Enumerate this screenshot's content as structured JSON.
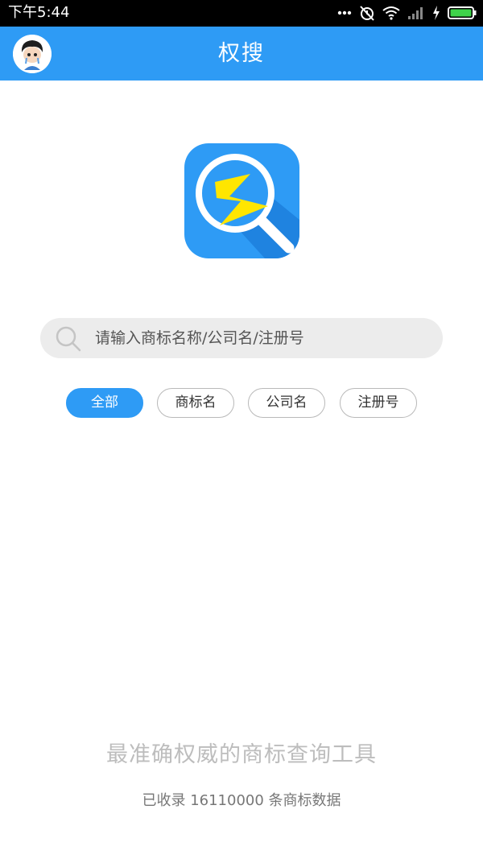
{
  "status_bar": {
    "time": "下午5:44",
    "icons": [
      "more-dots-icon",
      "alarm-off-icon",
      "wifi-icon",
      "signal-icon",
      "charging-icon",
      "battery-icon"
    ]
  },
  "header": {
    "title": "权搜",
    "avatar_icon": "user-avatar",
    "background_color": "#2e9bf5"
  },
  "logo": {
    "icon": "lightning-search-logo",
    "colors": {
      "background": "#2e9bf5",
      "bolt": "#ffe600",
      "lens": "#ffffff"
    }
  },
  "search": {
    "placeholder": "请输入商标名称/公司名/注册号",
    "icon": "search-icon"
  },
  "filters": {
    "items": [
      {
        "label": "全部",
        "active": true
      },
      {
        "label": "商标名",
        "active": false
      },
      {
        "label": "公司名",
        "active": false
      },
      {
        "label": "注册号",
        "active": false
      }
    ],
    "active_color": "#2e9bf5"
  },
  "footer": {
    "tagline": "最准确权威的商标查询工具",
    "record_count": "已收录 16110000 条商标数据"
  }
}
